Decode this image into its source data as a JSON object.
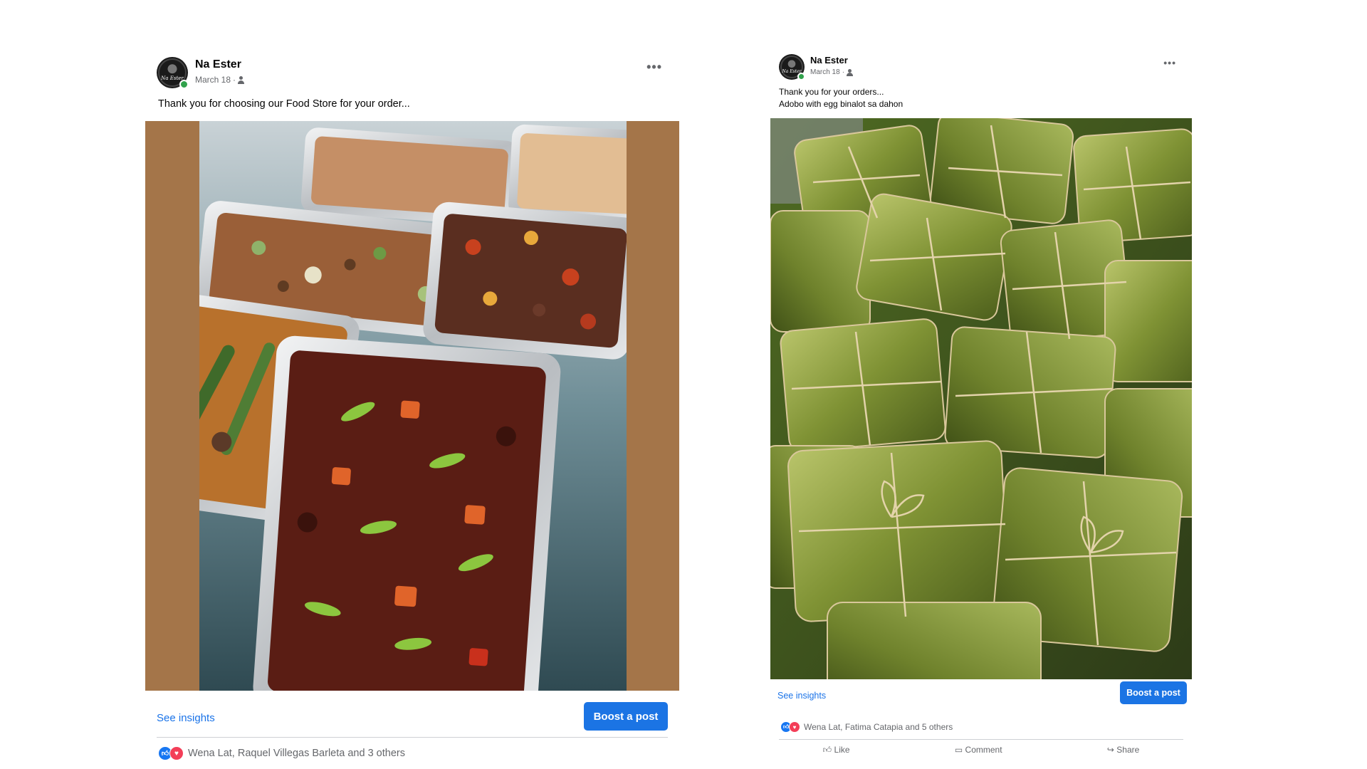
{
  "posts": [
    {
      "author": "Na Ester",
      "avatar_text": "Na Ester",
      "date": "March 18",
      "audience_icon": "people-icon",
      "more_icon": "more-options-icon",
      "caption_lines": [
        "Thank you for choosing our Food Store for your order..."
      ],
      "photo_description_icon": "food-trays-photo",
      "see_insights": "See insights",
      "boost_label": "Boost a post",
      "reactions_text": "Wena Lat, Raquel Villegas Barleta and 3 others"
    },
    {
      "author": "Na Ester",
      "avatar_text": "Na Ester",
      "date": "March 18",
      "audience_icon": "people-icon",
      "more_icon": "more-options-icon",
      "caption_lines": [
        "Thank you for your orders...",
        "Adobo with egg binalot sa dahon"
      ],
      "photo_description_icon": "banana-leaf-parcels-photo",
      "see_insights": "See insights",
      "boost_label": "Boost a post",
      "reactions_text": "Wena Lat, Fatima Catapia and 5 others",
      "actions": [
        "Like",
        "Comment",
        "Share"
      ]
    }
  ],
  "colors": {
    "accent": "#1b74e4",
    "link": "#1a73e8",
    "photo_backdrop": "#a47549",
    "online": "#31a24c"
  }
}
